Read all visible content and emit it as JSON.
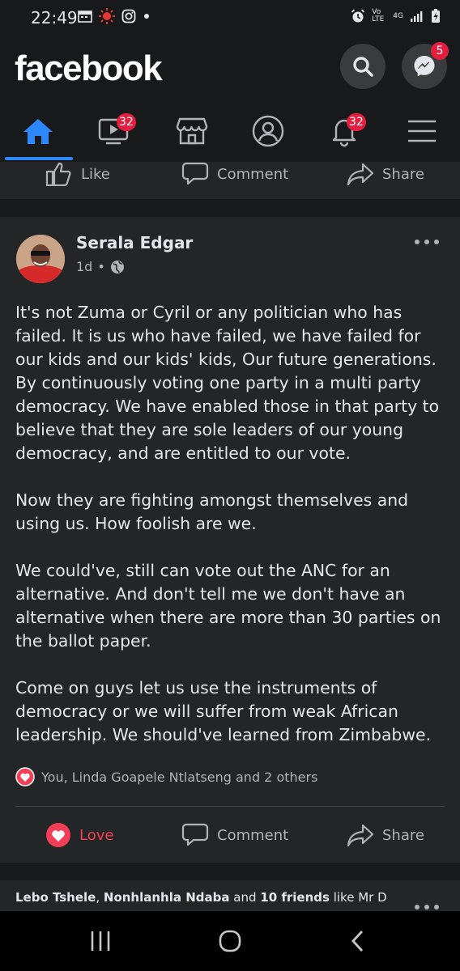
{
  "status_bar": {
    "time": "22:49",
    "network_top": "Vo LTE",
    "network_type": "4G"
  },
  "header": {
    "logo": "facebook",
    "messenger_badge": "5"
  },
  "tabs": {
    "watch_badge": "32",
    "notifications_badge": "32"
  },
  "previous_post_actions": {
    "like": "Like",
    "comment": "Comment",
    "share": "Share"
  },
  "post": {
    "author": "Serala Edgar",
    "time": "1d",
    "separator": "•",
    "paragraphs": [
      "It's not Zuma or Cyril or any politician who has failed. It is us who have failed, we have failed for our kids and our kids' kids, Our future generations. By continuously voting one party in a multi party democracy. We have enabled those in that party to believe that they are sole leaders of our young democracy, and are entitled to our vote.",
      "Now they are fighting amongst themselves and using us. How foolish are we.",
      "We could've, still can vote out the ANC for an alternative. And don't tell me we don't have an alternative when there are more than 30 parties on the ballot paper.",
      "Come on guys let us use the instruments of democracy or we will suffer from weak African leadership. We should've learned from Zimbabwe."
    ],
    "reactions_text": "You, Linda Goapele Ntlatseng and 2 others",
    "actions": {
      "love": "Love",
      "comment": "Comment",
      "share": "Share"
    },
    "colors": {
      "love": "#f33e58",
      "accent": "#2d88ff"
    }
  },
  "next_post": {
    "friend1": "Lebo Tshele",
    "sep": ", ",
    "friend2": "Nonhlanhla Ndaba",
    "and": " and ",
    "others": "10 friends",
    "like_text": " like Mr D"
  }
}
